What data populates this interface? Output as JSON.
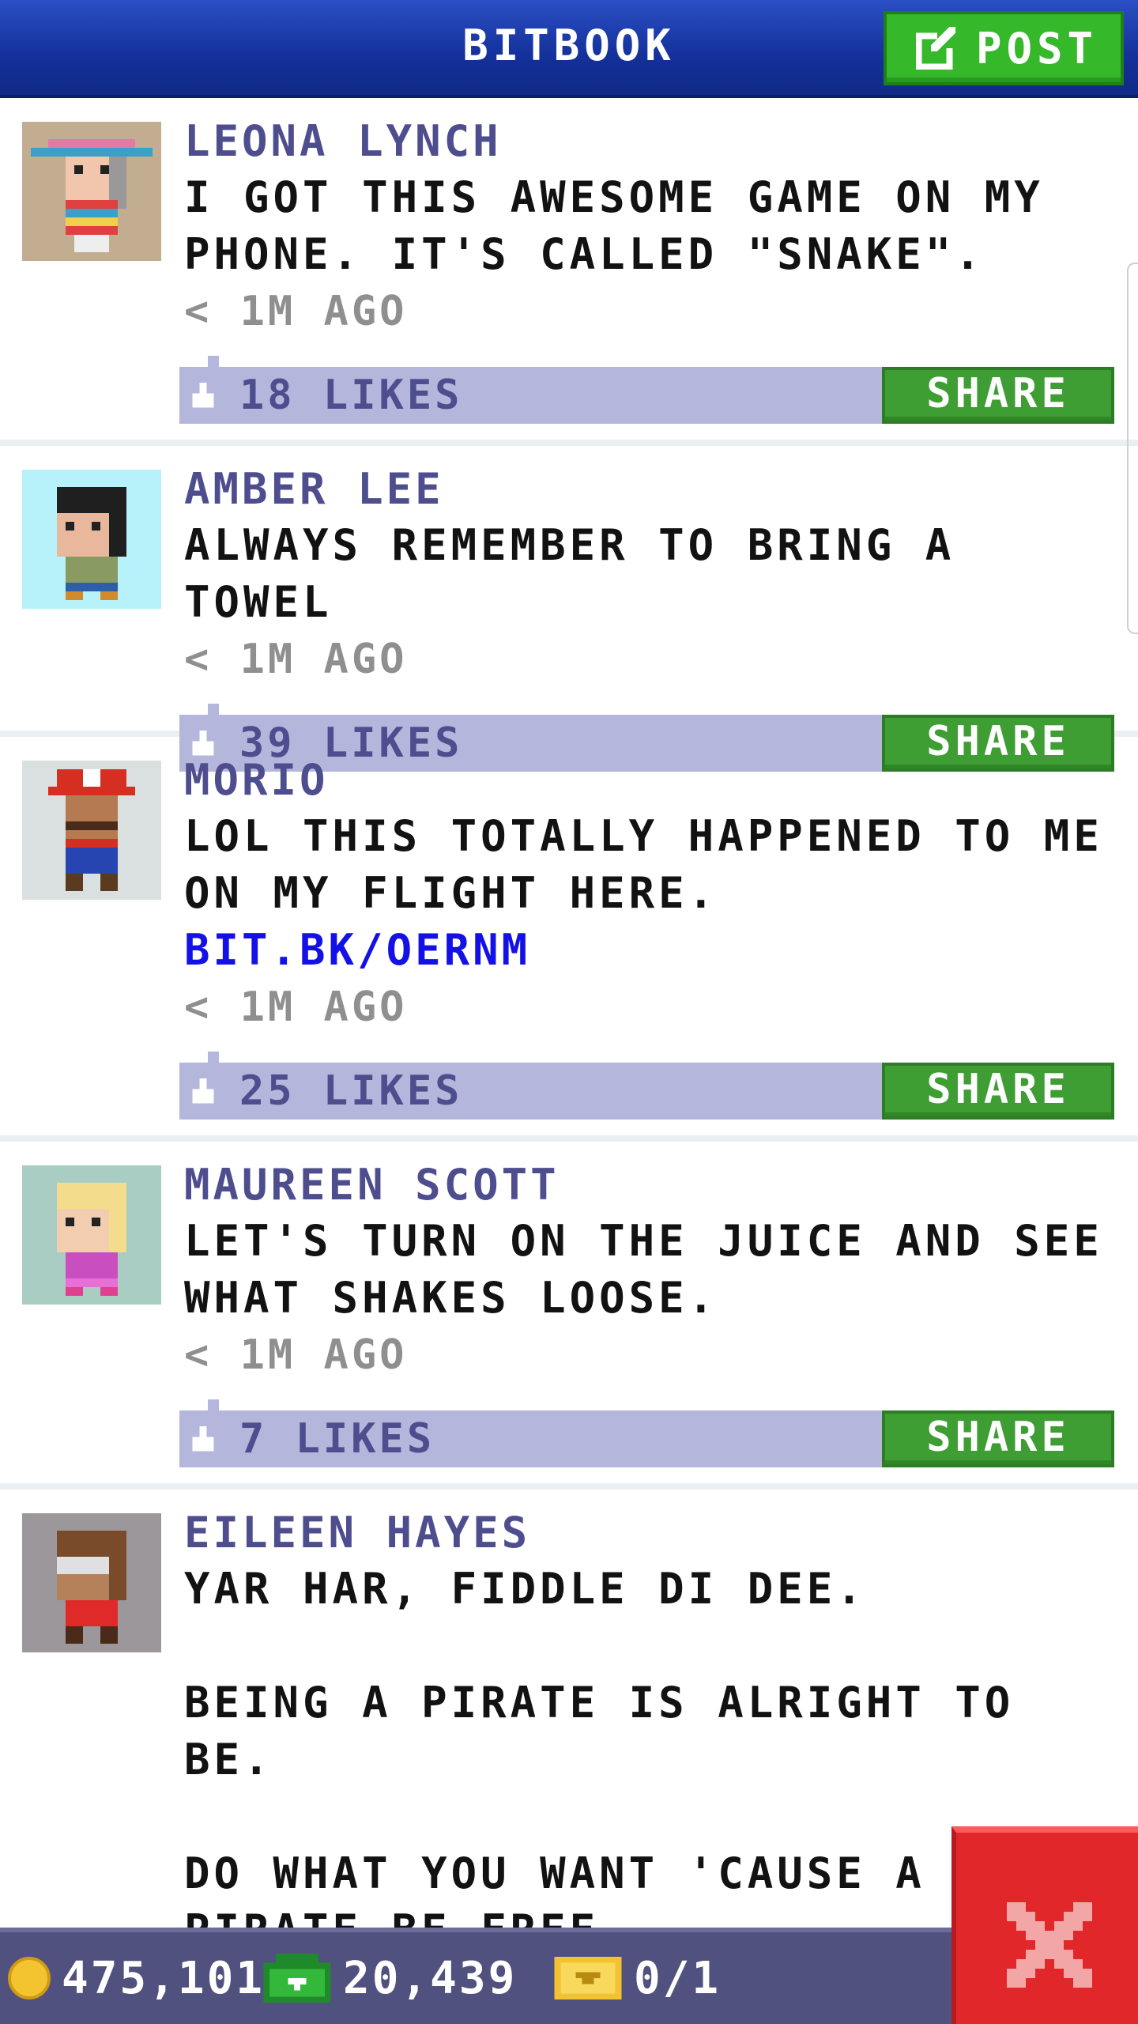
{
  "header": {
    "title": "BITBOOK",
    "post_label": "POST"
  },
  "posts": [
    {
      "author": "LEONA LYNCH",
      "message": "I GOT THIS AWESOME GAME ON MY PHONE. IT'S CALLED \"SNAKE\".",
      "link": "",
      "time": "< 1M AGO",
      "likes": "18 LIKES",
      "share": "SHARE",
      "avatar_bg": "#c2ad90"
    },
    {
      "author": "AMBER LEE",
      "message": "ALWAYS REMEMBER TO BRING A TOWEL",
      "link": "",
      "time": "< 1M AGO",
      "likes": "39 LIKES",
      "share": "SHARE",
      "avatar_bg": "#b7f2fb"
    },
    {
      "author": "MORIO",
      "message": "LOL THIS TOTALLY HAPPENED TO ME ON MY FLIGHT HERE.",
      "link": "BIT.BK/OERNM",
      "time": "< 1M AGO",
      "likes": "25 LIKES",
      "share": "SHARE",
      "avatar_bg": "#d9e0df"
    },
    {
      "author": "MAUREEN SCOTT",
      "message": "LET'S TURN ON THE JUICE AND SEE WHAT SHAKES LOOSE.",
      "link": "",
      "time": "< 1M AGO",
      "likes": "7 LIKES",
      "share": "SHARE",
      "avatar_bg": "#a9cdc2"
    },
    {
      "author": "EILEEN HAYES",
      "message": "YAR HAR, FIDDLE DI DEE.\n\nBEING A PIRATE IS ALRIGHT TO BE.\n\nDO WHAT YOU WANT 'CAUSE A PIRATE BE FREE.",
      "link": "",
      "time": "",
      "likes": "",
      "share": "",
      "avatar_bg": "#9b979b"
    }
  ],
  "currency": {
    "coins": "475,101",
    "bux": "20,439",
    "tickets": "0/1"
  },
  "colors": {
    "header": "#14309a",
    "post_button": "#36b82b",
    "share_button": "#3e9e33",
    "author": "#4e4e8f",
    "link": "#1411e6",
    "likes_bar": "#b4b7db",
    "bottom_bar": "#51517f",
    "close_button": "#e2272b"
  },
  "icons": {
    "post": "edit-icon",
    "like": "thumbs-up-icon",
    "coin": "coin-icon",
    "bux": "bux-icon",
    "ticket": "golden-ticket-icon",
    "close": "close-icon"
  }
}
